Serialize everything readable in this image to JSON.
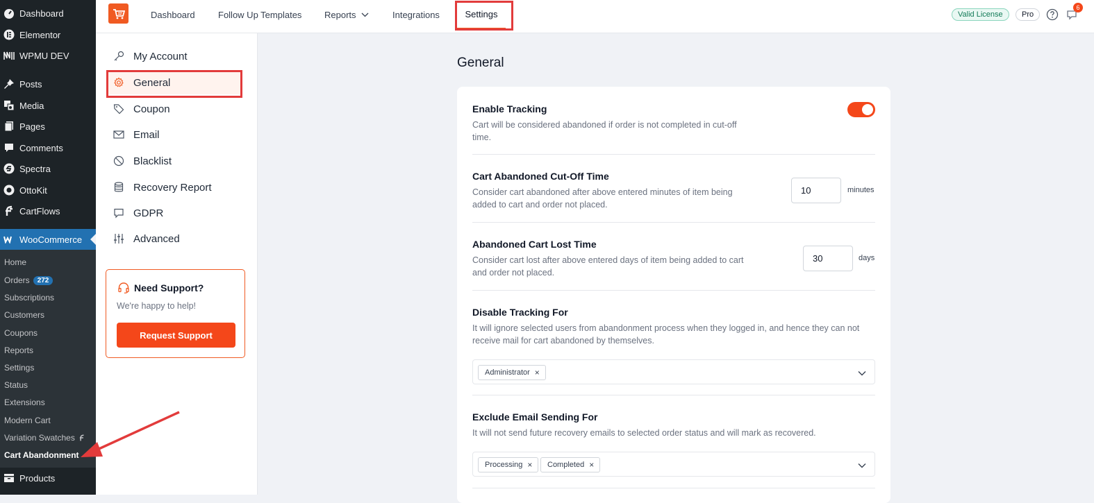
{
  "wp_menu": {
    "items": [
      {
        "label": "Dashboard",
        "icon": "dashboard-icon"
      },
      {
        "label": "Elementor",
        "icon": "elementor-icon"
      },
      {
        "label": "WPMU DEV",
        "icon": "wpmudev-icon"
      },
      {
        "label": "Posts",
        "icon": "pin-icon"
      },
      {
        "label": "Media",
        "icon": "media-icon"
      },
      {
        "label": "Pages",
        "icon": "pages-icon"
      },
      {
        "label": "Comments",
        "icon": "comment-icon"
      },
      {
        "label": "Spectra",
        "icon": "spectra-icon"
      },
      {
        "label": "OttoKit",
        "icon": "ottokit-icon"
      },
      {
        "label": "CartFlows",
        "icon": "cartflows-icon"
      },
      {
        "label": "WooCommerce",
        "icon": "woocommerce-icon"
      },
      {
        "label": "Products",
        "icon": "products-icon"
      }
    ],
    "woo_submenu": [
      {
        "label": "Home"
      },
      {
        "label": "Orders",
        "badge": "272"
      },
      {
        "label": "Subscriptions"
      },
      {
        "label": "Customers"
      },
      {
        "label": "Coupons"
      },
      {
        "label": "Reports"
      },
      {
        "label": "Settings"
      },
      {
        "label": "Status"
      },
      {
        "label": "Extensions"
      },
      {
        "label": "Modern Cart"
      },
      {
        "label": "Variation Swatches"
      },
      {
        "label": "Cart Abandonment"
      }
    ]
  },
  "topnav": {
    "tabs": [
      "Dashboard",
      "Follow Up Templates",
      "Reports",
      "Integrations",
      "Settings"
    ],
    "license_badge": "Valid License",
    "plan_badge": "Pro",
    "notification_count": "6"
  },
  "settings_nav": {
    "items": [
      "My Account",
      "General",
      "Coupon",
      "Email",
      "Blacklist",
      "Recovery Report",
      "GDPR",
      "Advanced"
    ],
    "selected": "General"
  },
  "support": {
    "title": "Need Support?",
    "subtitle": "We're happy to help!",
    "button": "Request Support"
  },
  "main": {
    "title": "General",
    "enable_tracking": {
      "title": "Enable Tracking",
      "desc": "Cart will be considered abandoned if order is not completed in cut-off time.",
      "enabled": true
    },
    "cutoff": {
      "title": "Cart Abandoned Cut-Off Time",
      "desc": "Consider cart abandoned after above entered minutes of item being added to cart and order not placed.",
      "value": "10",
      "unit": "minutes"
    },
    "lost_time": {
      "title": "Abandoned Cart Lost Time",
      "desc": "Consider cart lost after above entered days of item being added to cart and order not placed.",
      "value": "30",
      "unit": "days"
    },
    "disable_tracking": {
      "title": "Disable Tracking For",
      "desc": "It will ignore selected users from abandonment process when they logged in, and hence they can not receive mail for cart abandoned by themselves.",
      "tags": [
        "Administrator"
      ]
    },
    "exclude_email": {
      "title": "Exclude Email Sending For",
      "desc": "It will not send future recovery emails to selected order status and will mark as recovered.",
      "tags": [
        "Processing",
        "Completed"
      ]
    }
  },
  "colors": {
    "accent": "#f4471a",
    "wp_sidebar": "#1d2327",
    "wp_active": "#2271b1",
    "highlight": "#e23b3b"
  }
}
